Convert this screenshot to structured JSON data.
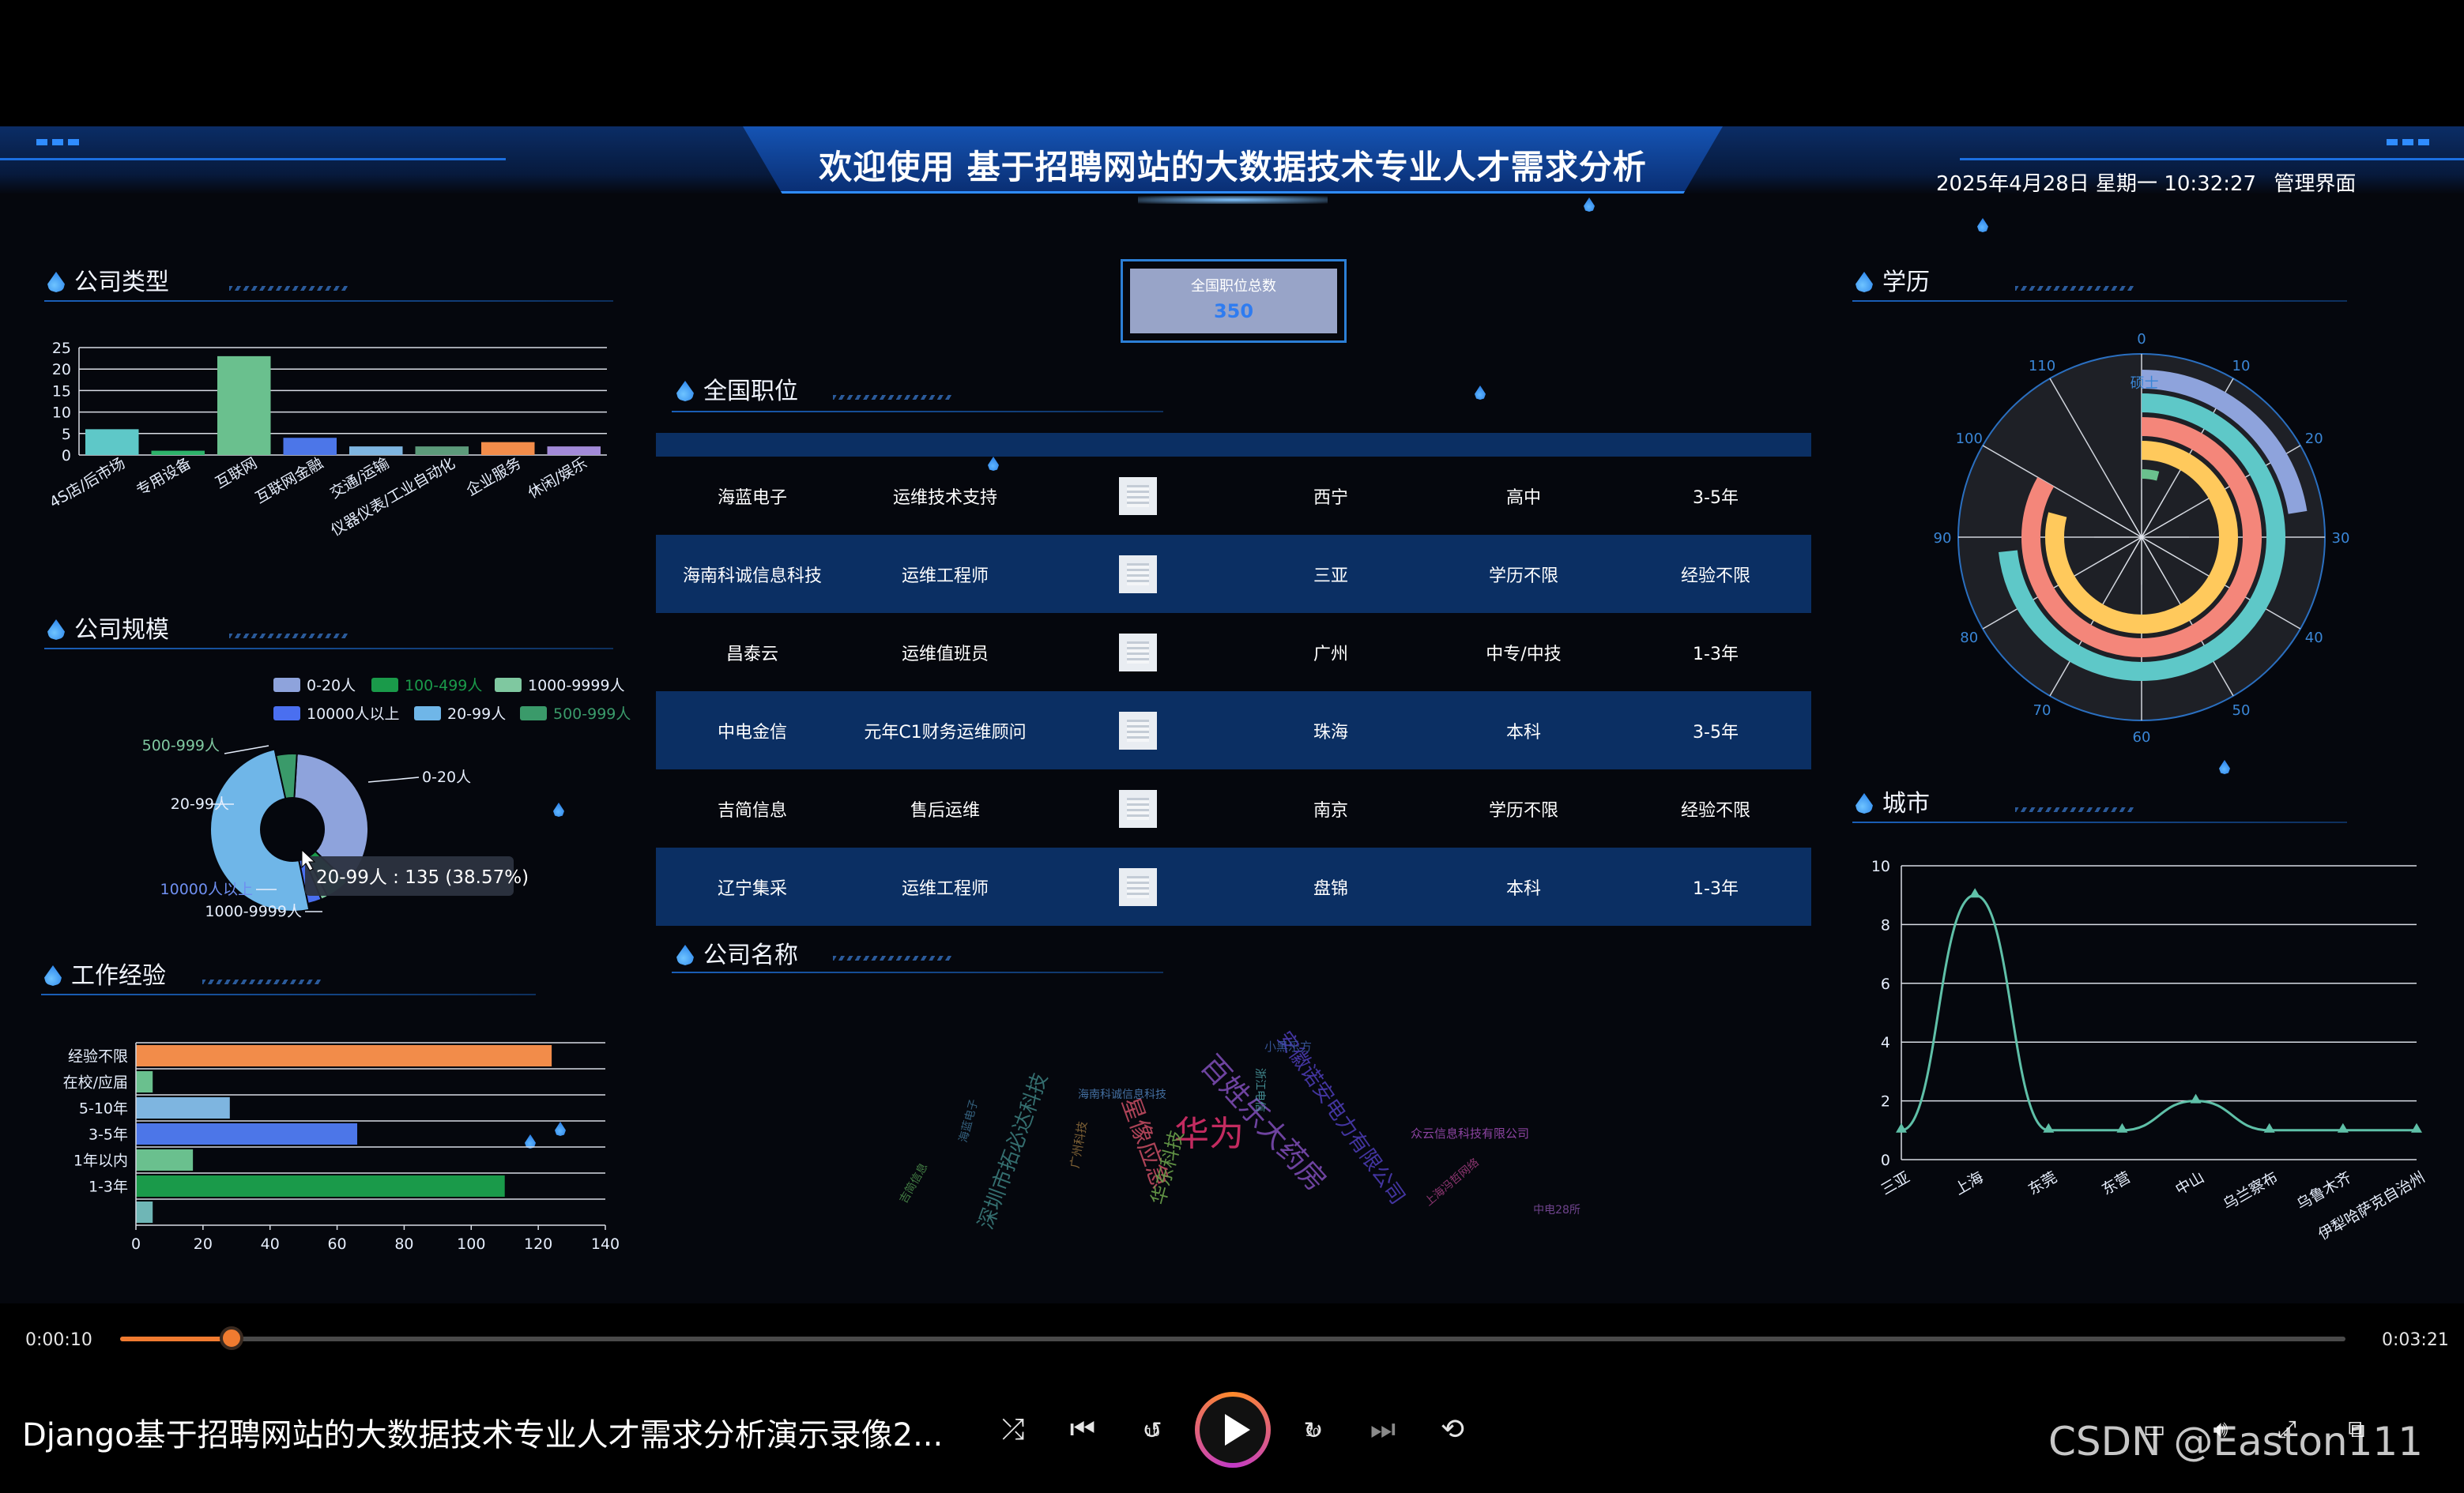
{
  "header": {
    "title": "欢迎使用 基于招聘网站的大数据技术专业人才需求分析",
    "datetime": "2025年4月28日 星期一 10:32:27",
    "admin_link": "管理界面"
  },
  "panels": {
    "company_type": "公司类型",
    "company_size": "公司规模",
    "experience": "工作经验",
    "national_jobs": "全国职位",
    "company_name": "公司名称",
    "education": "学历",
    "city": "城市"
  },
  "total": {
    "label": "全国职位总数",
    "value": "350"
  },
  "jobs_table": {
    "rows": [
      {
        "company": "海蓝电子",
        "title": "运维技术支持",
        "city": "西宁",
        "education": "高中",
        "experience": "3-5年"
      },
      {
        "company": "海南科诚信息科技",
        "title": "运维工程师",
        "city": "三亚",
        "education": "学历不限",
        "experience": "经验不限"
      },
      {
        "company": "昌泰云",
        "title": "运维值班员",
        "city": "广州",
        "education": "中专/中技",
        "experience": "1-3年"
      },
      {
        "company": "中电金信",
        "title": "元年C1财务运维顾问",
        "city": "珠海",
        "education": "本科",
        "experience": "3-5年"
      },
      {
        "company": "吉简信息",
        "title": "售后运维",
        "city": "南京",
        "education": "学历不限",
        "experience": "经验不限"
      },
      {
        "company": "辽宁集采",
        "title": "运维工程师",
        "city": "盘锦",
        "education": "本科",
        "experience": "1-3年"
      }
    ]
  },
  "wordcloud": {
    "words": [
      "华为",
      "百姓乐大药房",
      "深圳市拓必达科技",
      "星像应急",
      "华东科技",
      "安徽诺安电力有限公司",
      "众云信息科技有限公司",
      "广州科技",
      "小黑乐方",
      "海南科诚信息科技",
      "上海冯哲网络",
      "中电28所",
      "海蓝电子",
      "吉简信息",
      "浙江电信"
    ]
  },
  "player": {
    "current_time": "0:00:10",
    "total_time": "0:03:21",
    "progress": 0.05,
    "video_title": "Django基于招聘网站的大数据技术专业人才需求分析演示录像2...",
    "watermark": "CSDN @Easton111",
    "skip_back_label": "10",
    "skip_fwd_label": "30"
  },
  "chart_data": [
    {
      "type": "bar",
      "panel": "公司类型",
      "categories": [
        "4S店/后市场",
        "专用设备",
        "互联网",
        "互联网金融",
        "交通/运输",
        "仪器仪表/工业自动化",
        "企业服务",
        "休闲/娱乐"
      ],
      "values": [
        6,
        1,
        23,
        4,
        2,
        2,
        3,
        2
      ],
      "colors": [
        "#5ec8c8",
        "#2db36a",
        "#6ac08e",
        "#4c76e8",
        "#7eb5e0",
        "#5c9a7a",
        "#f28c4a",
        "#a28ad8"
      ],
      "ylim": [
        0,
        25
      ],
      "yticks": [
        0,
        5,
        10,
        15,
        20,
        25
      ]
    },
    {
      "type": "pie",
      "panel": "公司规模",
      "legend": [
        {
          "name": "0-20人",
          "color": "#8ea3dc"
        },
        {
          "name": "100-499人",
          "color": "#1a9a4a"
        },
        {
          "name": "1000-9999人",
          "color": "#7fc8a0"
        },
        {
          "name": "10000人以上",
          "color": "#4a6ff0"
        },
        {
          "name": "20-99人",
          "color": "#6fb6e8"
        },
        {
          "name": "500-999人",
          "color": "#3a9a6a"
        }
      ],
      "slices": [
        {
          "name": "0-20人",
          "value": 98
        },
        {
          "name": "100-499人",
          "value": 14
        },
        {
          "name": "1000-9999人",
          "value": 4
        },
        {
          "name": "10000人以上",
          "value": 8
        },
        {
          "name": "20-99人",
          "value": 135
        },
        {
          "name": "500-999人",
          "value": 12
        }
      ],
      "shown_labels": [
        "500-999人",
        "0-20人",
        "20-99人",
        "10000人以上",
        "1000-9999人"
      ],
      "tooltip": "20-99人 : 135 (38.57%)"
    },
    {
      "type": "bar",
      "orientation": "horizontal",
      "panel": "工作经验",
      "categories": [
        "经验不限",
        "在校/应届",
        "5-10年",
        "3-5年",
        "1年以内",
        "1-3年",
        ""
      ],
      "values": [
        124,
        5,
        28,
        66,
        17,
        110,
        5
      ],
      "colors": [
        "#f28c4a",
        "#6ac08e",
        "#7eb5e0",
        "#4c76e8",
        "#6ac08e",
        "#1a9a4a",
        "#6fb6b6"
      ],
      "xlim": [
        0,
        140
      ],
      "xticks": [
        0,
        20,
        40,
        60,
        80,
        100,
        120,
        140
      ]
    },
    {
      "type": "polar-bar",
      "panel": "学历",
      "angle_ticks": [
        0,
        10,
        20,
        30,
        40,
        50,
        60,
        70,
        80,
        90,
        100,
        110
      ],
      "angle_max": 120,
      "series": [
        {
          "label": "硕士",
          "value": 27,
          "color": "#8ea3dc"
        },
        {
          "label": "",
          "value": 88,
          "color": "#5ec8c8"
        },
        {
          "label": "",
          "value": 100,
          "color": "#f4867a"
        },
        {
          "label": "",
          "value": 95,
          "color": "#ffc95c"
        },
        {
          "label": "",
          "value": 5,
          "color": "#6ac08e"
        }
      ]
    },
    {
      "type": "line",
      "panel": "城市",
      "categories": [
        "三亚",
        "上海",
        "东莞",
        "东营",
        "中山",
        "乌兰察布",
        "乌鲁木齐",
        "伊犁哈萨克自治州"
      ],
      "values": [
        1,
        9,
        1,
        1,
        2,
        1,
        1,
        1
      ],
      "color": "#5fc0a8",
      "ylim": [
        0,
        10
      ],
      "yticks": [
        0,
        2,
        4,
        6,
        8,
        10
      ]
    }
  ]
}
